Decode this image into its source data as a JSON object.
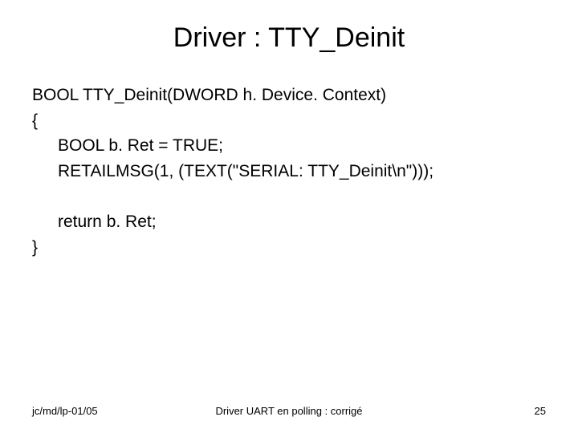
{
  "title": "Driver : TTY_Deinit",
  "code": {
    "l1": "BOOL TTY_Deinit(DWORD h. Device. Context)",
    "l2": "{",
    "l3": "BOOL b. Ret = TRUE;",
    "l4": "RETAILMSG(1, (TEXT(\"SERIAL: TTY_Deinit\\n\")));",
    "l5": "return b. Ret;",
    "l6": "}"
  },
  "footer": {
    "left": "jc/md/lp-01/05",
    "center": "Driver UART en polling : corrigé",
    "right": "25"
  }
}
